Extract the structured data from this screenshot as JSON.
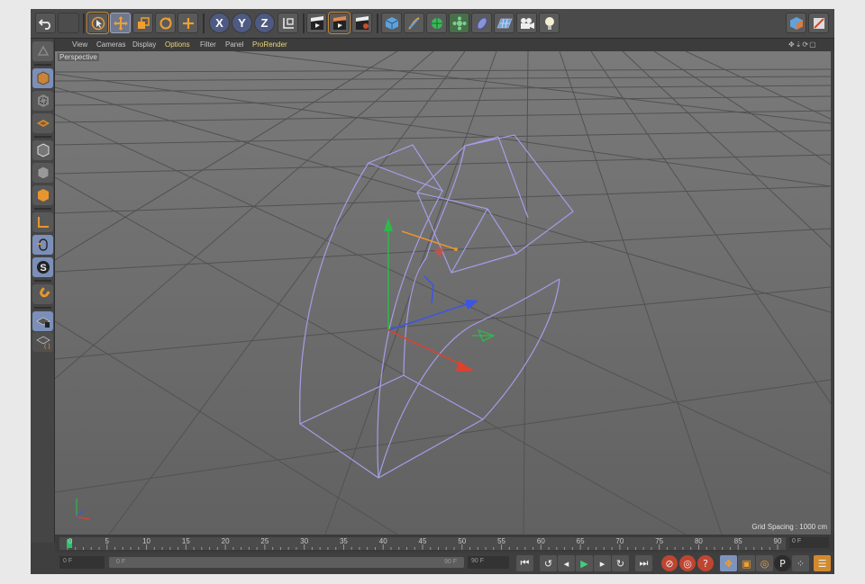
{
  "menubar": {
    "items": [
      "View",
      "Cameras",
      "Display",
      "Options",
      "Filter",
      "Panel",
      "ProRender"
    ],
    "highlighted": [
      "Options",
      "ProRender"
    ]
  },
  "toolbar": {
    "tools": [
      "undo-icon",
      "redo-icon",
      "select-icon",
      "move-icon",
      "scale-icon",
      "rotate-icon",
      "add-icon"
    ],
    "axes": [
      "X",
      "Y",
      "Z"
    ],
    "coordinate_icon": "world-coordinate-icon",
    "render_tools": [
      "render-view-icon",
      "render-picture-viewer-icon",
      "render-settings-icon"
    ],
    "object_tools": [
      "cube-icon",
      "pen-icon",
      "subdivision-icon",
      "array-icon",
      "deformer-icon",
      "floor-icon",
      "camera-icon",
      "light-icon"
    ],
    "layout_icons": [
      "layout-cube-icon",
      "layout-edit-icon"
    ]
  },
  "sidebar": {
    "tools": [
      "model-mode-icon",
      "texture-mode-icon",
      "workplane-icon",
      "points-mode-icon",
      "edges-mode-icon",
      "polygons-mode-icon",
      "axis-mode-icon",
      "tweak-icon",
      "solo-icon",
      "snap-icon",
      "workplane-lock-icon",
      "grid-lock-icon"
    ]
  },
  "viewport": {
    "label": "Perspective",
    "grid_spacing": "Grid Spacing : 1000 cm",
    "nav_icons": "✥⇣⟳▢"
  },
  "timeline": {
    "ticks": [
      "0",
      "5",
      "10",
      "15",
      "20",
      "25",
      "30",
      "35",
      "40",
      "45",
      "50",
      "55",
      "60",
      "65",
      "70",
      "75",
      "80",
      "85",
      "90"
    ],
    "current_frame": "0 F"
  },
  "controls": {
    "start_field": "0 F",
    "slider_start": "0 F",
    "slider_end": "90 F",
    "end_field": "90 F",
    "playback": [
      "go-to-start-icon",
      "previous-key-icon",
      "previous-frame-icon",
      "play-icon",
      "next-frame-icon",
      "next-key-icon",
      "go-to-end-icon"
    ],
    "record": [
      "record-active-icon",
      "autokey-icon",
      "keyframe-selection-icon"
    ],
    "key_types": [
      "key-position-icon",
      "key-scale-icon",
      "key-rotation-icon",
      "key-parameter-icon",
      "key-pla-icon",
      "timeline-icon"
    ]
  },
  "colors": {
    "accent_orange": "#d28a2d",
    "selection_blue": "#7b8fb8",
    "wireframe": "#a49de8",
    "x_axis": "#e0402e",
    "y_axis": "#2fb84a",
    "z_axis": "#3b55e6",
    "playhead": "#24c46c"
  }
}
